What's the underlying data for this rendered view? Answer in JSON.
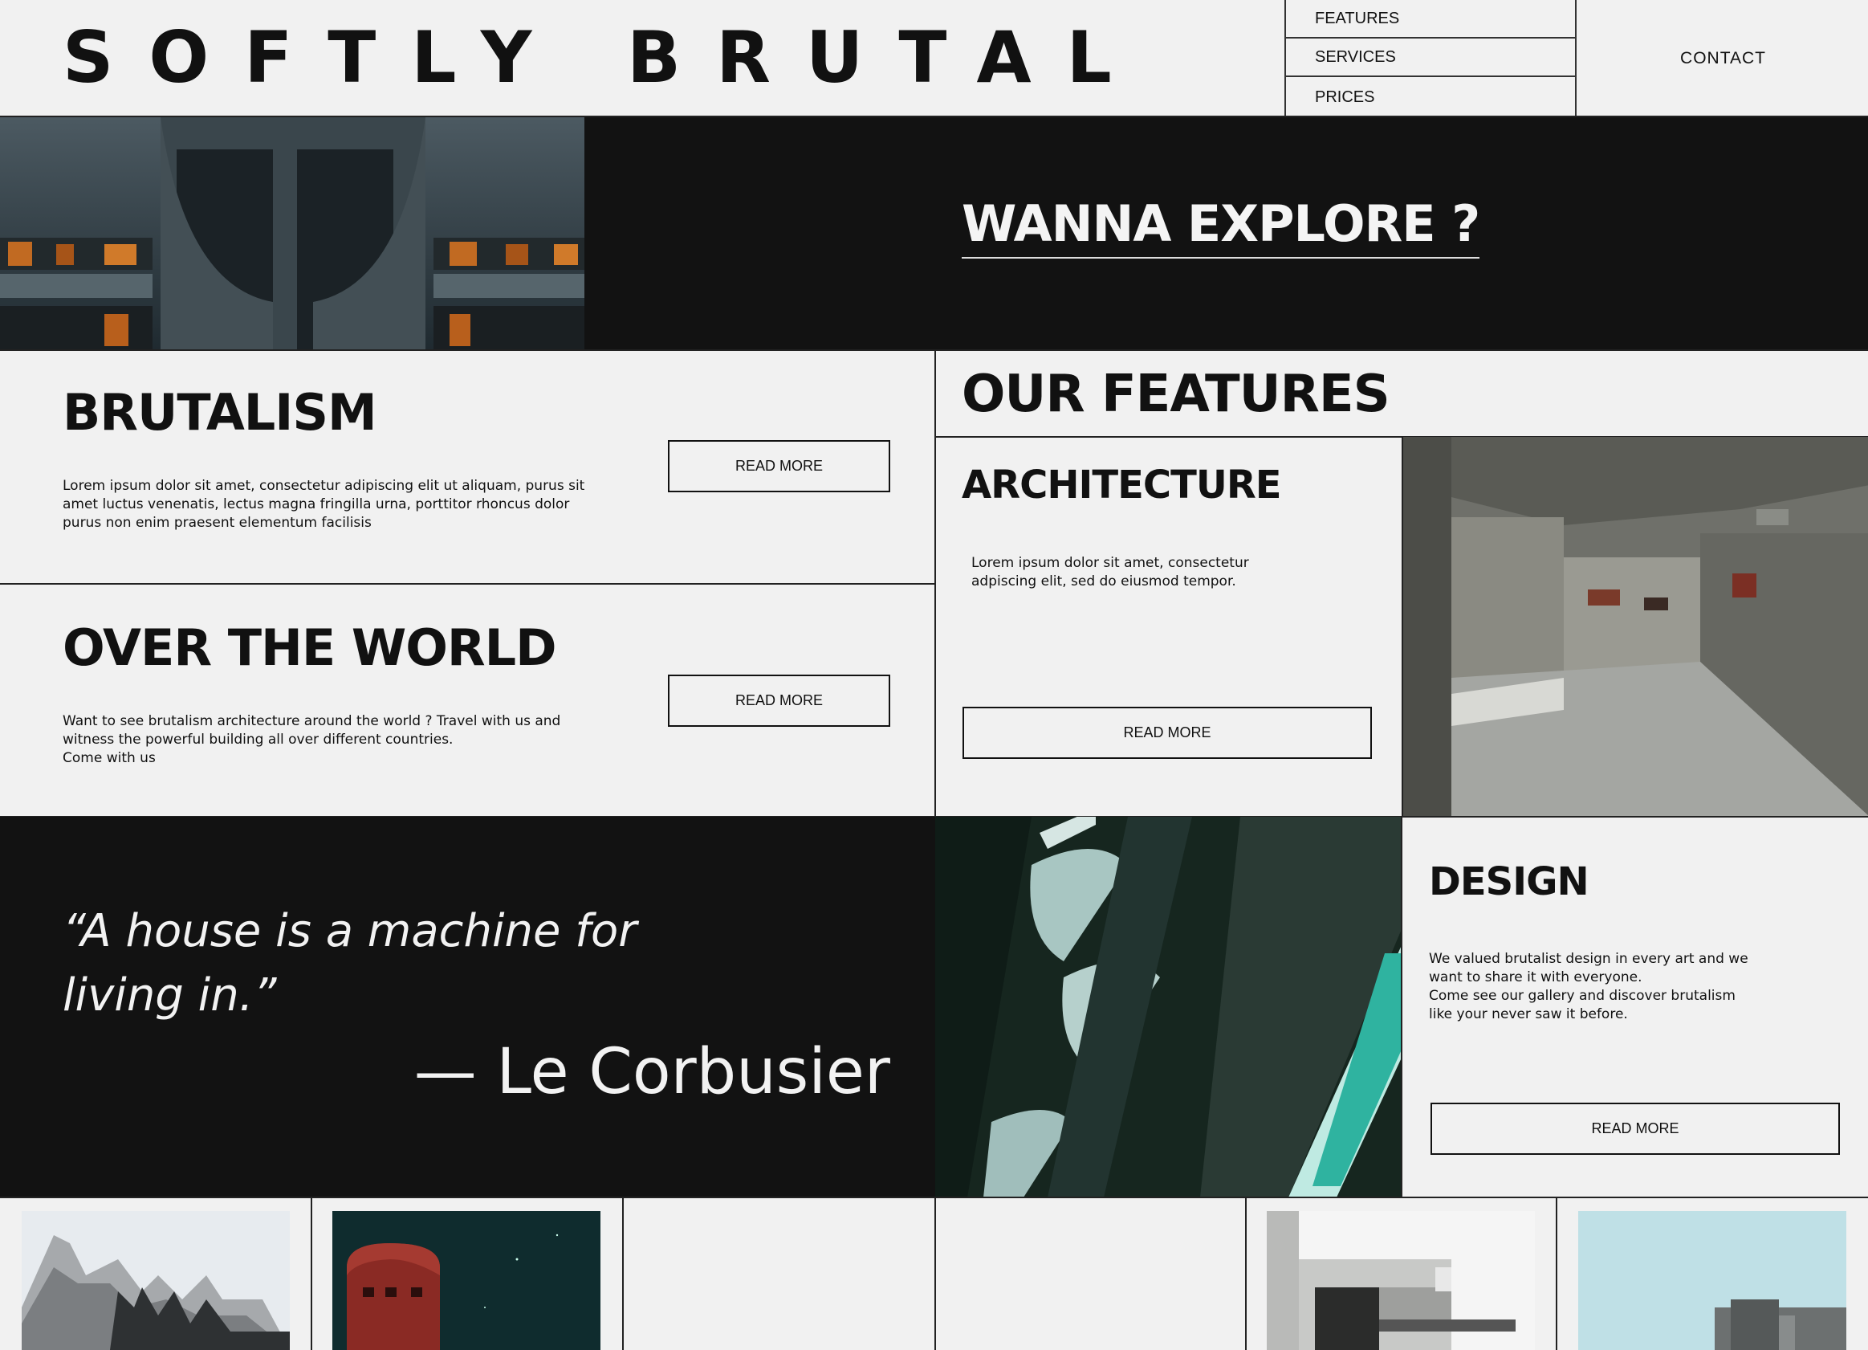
{
  "brand": {
    "title": "SOFTLY BRUTAL"
  },
  "nav": {
    "items": [
      {
        "label": "FEATURES"
      },
      {
        "label": "SERVICES"
      },
      {
        "label": "PRICES"
      }
    ],
    "contact": "CONTACT"
  },
  "hero": {
    "cta": "WANNA EXPLORE ?"
  },
  "brutalism": {
    "title": "BRUTALISM",
    "text": "Lorem ipsum dolor sit amet, consectetur adipiscing elit ut aliquam, purus sit\namet luctus venenatis, lectus magna fringilla urna, porttitor rhoncus dolor\npurus non enim praesent elementum facilisis",
    "button": "READ MORE"
  },
  "world": {
    "title": "OVER THE WORLD",
    "text": "Want to see brutalism architecture around the world ? Travel with us and\nwitness the powerful building all over different countries.\nCome with us",
    "button": "READ MORE"
  },
  "features": {
    "heading": "OUR FEATURES",
    "architecture": {
      "title": "ARCHITECTURE",
      "text": "Lorem ipsum dolor sit amet, consectetur\nadpiscing elit, sed do eiusmod tempor.",
      "button": "READ MORE"
    },
    "design": {
      "title": "DESIGN",
      "text": "We valued brutalist design in every art and we\nwant to share it with everyone.\nCome see our gallery and discover brutalism\nlike your never saw it before.",
      "button": "READ MORE"
    }
  },
  "quote": {
    "text": "“A house is a machine for\nliving in.”",
    "author": "— Le Corbusier"
  },
  "colors": {
    "dark": "#111111",
    "light": "#f1f1f1",
    "accent_teal": "#2fb3a0"
  }
}
